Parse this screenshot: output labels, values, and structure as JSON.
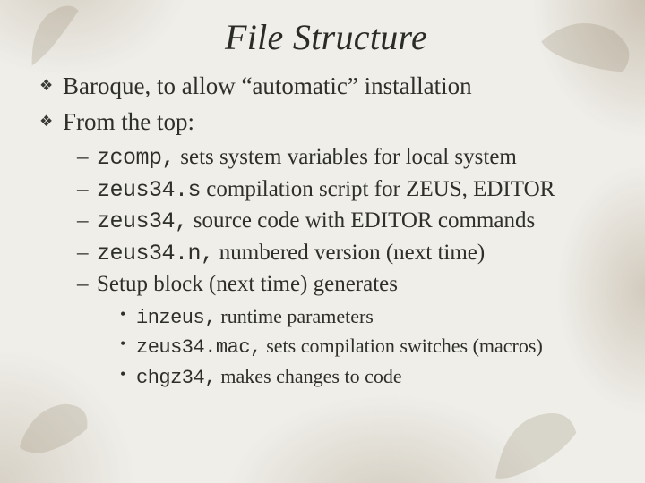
{
  "title": "File Structure",
  "bullets": [
    {
      "text_pre": "Baroque, to allow “automatic” installation"
    },
    {
      "text_pre": "From the top:"
    }
  ],
  "level2": [
    {
      "code": "zcomp,",
      "rest": " sets system variables for local system"
    },
    {
      "code": "zeus34.s",
      "rest": "  compilation script for ZEUS, EDITOR"
    },
    {
      "code": "zeus34,",
      "rest": " source code with EDITOR commands"
    },
    {
      "code": "zeus34.n,",
      "rest": "  numbered version (next time)"
    },
    {
      "code": "",
      "rest": "Setup block (next time) generates"
    }
  ],
  "level3": [
    {
      "code": "inzeus,",
      "rest": " runtime parameters"
    },
    {
      "code": "zeus34.mac,",
      "rest": " sets compilation switches (macros)"
    },
    {
      "code": "chgz34,",
      "rest": "  makes changes to code"
    }
  ],
  "glyphs": {
    "diamond": "❖",
    "dash": "–",
    "dot": "•"
  }
}
